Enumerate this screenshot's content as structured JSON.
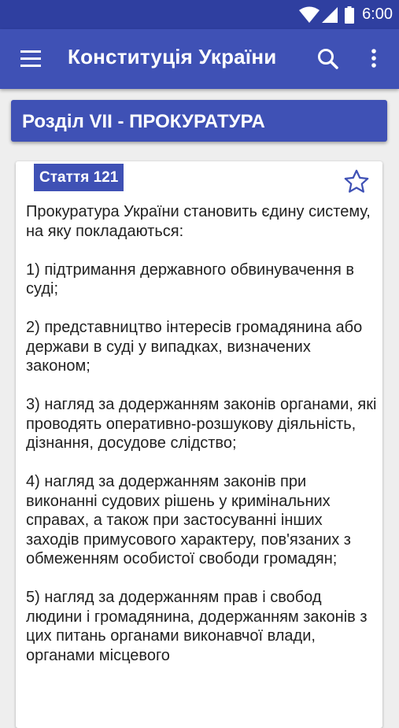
{
  "status_bar": {
    "time": "6:00",
    "icons": [
      "wifi-icon",
      "signal-icon",
      "battery-icon"
    ]
  },
  "app_bar": {
    "title": "Конституція України",
    "icons": [
      "menu-icon",
      "search-icon",
      "more-vertical-icon"
    ]
  },
  "section": {
    "title": "Розділ VII - ПРОКУРАТУРА"
  },
  "article": {
    "label": "Стаття 121",
    "favorite_icon": "star-outline-icon",
    "paragraphs": [
      "Прокуратура України становить єдину систему, на яку покладаються:",
      "1) підтримання державного обвинувачення в суді;",
      "2) представництво інтересів громадянина або держави в суді у випадках, визначених законом;",
      "3) нагляд за додержанням законів органами, які проводять оперативно-розшукову діяльність, дізнання, досудове слідство;",
      "4) нагляд за додержанням законів при виконанні судових рішень у кримінальних справах, а також при застосуванні інших заходів примусового характеру, пов'язаних з обмеженням особистої свободи громадян;",
      "5) нагляд за додержанням прав і свобод людини і громадянина, додержанням законів з цих питань органами виконавчої влади, органами місцевого"
    ]
  },
  "colors": {
    "primary": "#3f51b5",
    "primary_dark": "#2f3fa0",
    "background": "#eeeeee",
    "card": "#ffffff",
    "text": "#212121"
  }
}
